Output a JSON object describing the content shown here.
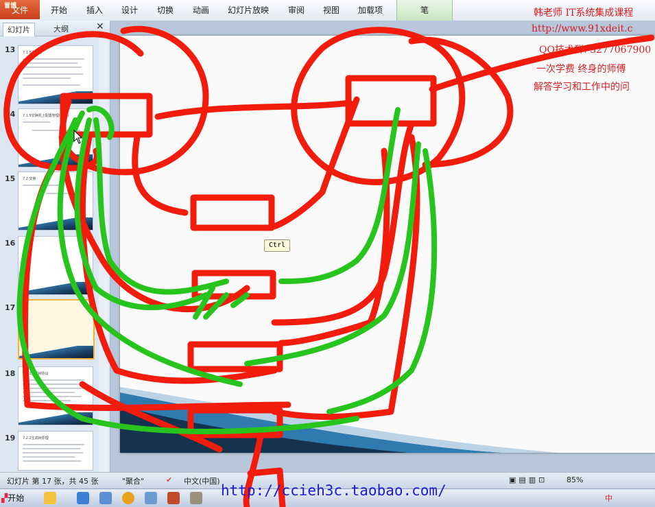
{
  "ribbon": {
    "file": "文件",
    "logo": "冒博",
    "tabs": [
      "开始",
      "插入",
      "设计",
      "切换",
      "动画",
      "幻灯片放映",
      "审阅",
      "视图",
      "加载项"
    ],
    "pen_tab": "笔"
  },
  "panel": {
    "tab_slides": "幻灯片",
    "tab_outline": "大纲",
    "close": "✕",
    "thumbs": [
      {
        "num": "13",
        "title": "7.1.5连接器"
      },
      {
        "num": "14",
        "title": "7.1.5交换机上配置管理IP接口"
      },
      {
        "num": "15",
        "title": "7.2 交换"
      },
      {
        "num": "16",
        "title": ""
      },
      {
        "num": "17",
        "title": ""
      },
      {
        "num": "18",
        "title": "7.2.1生成树协议"
      },
      {
        "num": "19",
        "title": "7.2.2生成树原理"
      }
    ]
  },
  "watermark": {
    "line1": "韩老师 IT系统集成课程",
    "line2": "http://www.91xdeit.c",
    "line3": "QQ技术群: 3277067900",
    "line4": "一次学费   终身的师傅",
    "line5": "解答学习和工作中的问"
  },
  "tooltip": "Ctrl",
  "status": {
    "slide_info": "幻灯片 第 17 张，共 45 张",
    "theme": "\"聚合\"",
    "language": "中文(中国)",
    "zoom": "85%"
  },
  "taskbar": {
    "start": "开始",
    "url": "http://ccieh3c.taobao.com/",
    "ime": "中"
  },
  "colors": {
    "ink_red": "#f21c0c",
    "ink_green": "#26c41c",
    "watermark": "#d41e1e",
    "url": "#1b1bd8"
  }
}
